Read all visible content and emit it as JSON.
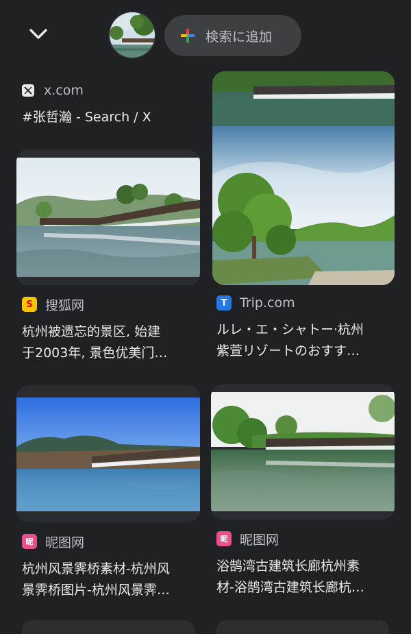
{
  "header": {
    "add_to_search_label": "検索に追加",
    "thumbnail_icon": "lake-thumbnail"
  },
  "colors": {
    "background": "#202124",
    "pill": "#3c4043",
    "text": "#e8eaed",
    "muted": "#bdc1c6"
  },
  "results": [
    {
      "source": "x.com",
      "title_lines": [
        "#张哲瀚 - Search / X"
      ]
    },
    {
      "source": "Trip.com",
      "title_lines": [
        "ルレ・エ・シャトー·杭州",
        "紫萱リゾートのおすす…"
      ]
    },
    {
      "source": "搜狐网",
      "title_lines": [
        "杭州被遗忘的景区, 始建",
        "于2003年, 景色优美门…"
      ]
    },
    {
      "source": "昵图网",
      "title_lines": [
        "杭州风景霁桥素材-杭州风",
        "景霁桥图片-杭州风景霁…"
      ]
    },
    {
      "source": "昵图网",
      "title_lines": [
        "浴鹄湾古建筑长廊杭州素",
        "材-浴鹄湾古建筑长廊杭…"
      ]
    }
  ]
}
